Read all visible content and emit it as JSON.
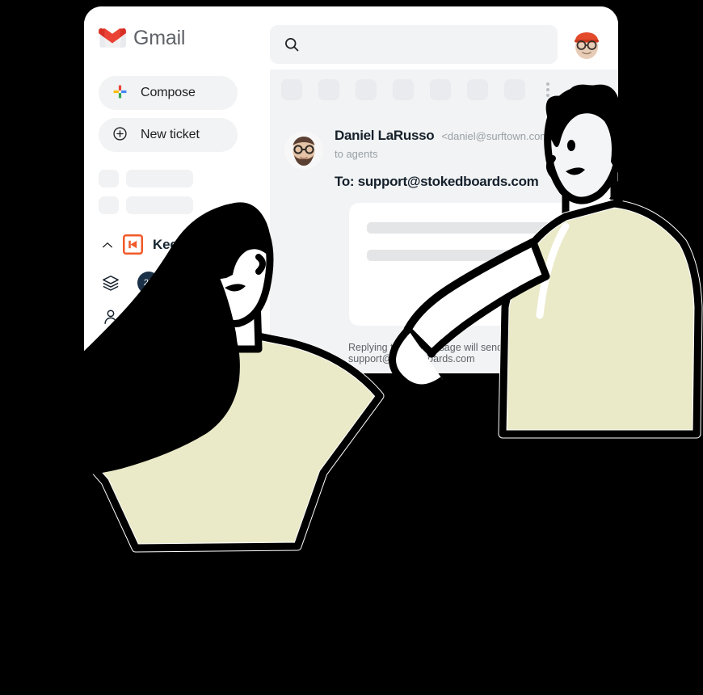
{
  "window": {
    "brand": {
      "name": "Gmail",
      "logo_icon": "gmail-logo-icon"
    },
    "search": {
      "value": "",
      "placeholder": "",
      "icon": "search-icon"
    },
    "account_avatar_icon": "user-avatar-icon"
  },
  "sidebar": {
    "compose": {
      "label": "Compose",
      "icon": "plus-multicolor-icon"
    },
    "new_ticket": {
      "label": "New ticket",
      "icon": "plus-circle-icon"
    },
    "skeleton_rows": 2,
    "section": {
      "label": "Keeping",
      "logo_icon": "keeping-logo-icon",
      "collapse_icon": "chevron-up-icon",
      "expanded": true
    },
    "nav_items": [
      {
        "icon": "layers-icon",
        "badge": "27",
        "label": ""
      },
      {
        "icon": "person-icon",
        "badge": "",
        "label": ""
      },
      {
        "icon": "person-outline-icon",
        "badge": "",
        "label": ""
      }
    ]
  },
  "toolbar": {
    "placeholder_buttons": 7,
    "overflow_icon": "more-vertical-icon"
  },
  "email": {
    "sender_name": "Daniel LaRusso",
    "sender_email": "<daniel@surftown.com>",
    "to_label": "to agents",
    "recipient": "To: support@stokedboards.com",
    "avatar_icon": "sender-avatar-icon",
    "body_placeholder_bars": [
      100,
      72
    ],
    "footnote": "Replying to this message will send from support@stokedboards.com"
  },
  "colors": {
    "gmail_red": "#d93025",
    "keeping_orange": "#f15a29",
    "badge_navy": "#1b3147",
    "shirt_cream": "#eaeac9",
    "panel_grey": "#f1f3f4",
    "page_black": "#000000"
  }
}
